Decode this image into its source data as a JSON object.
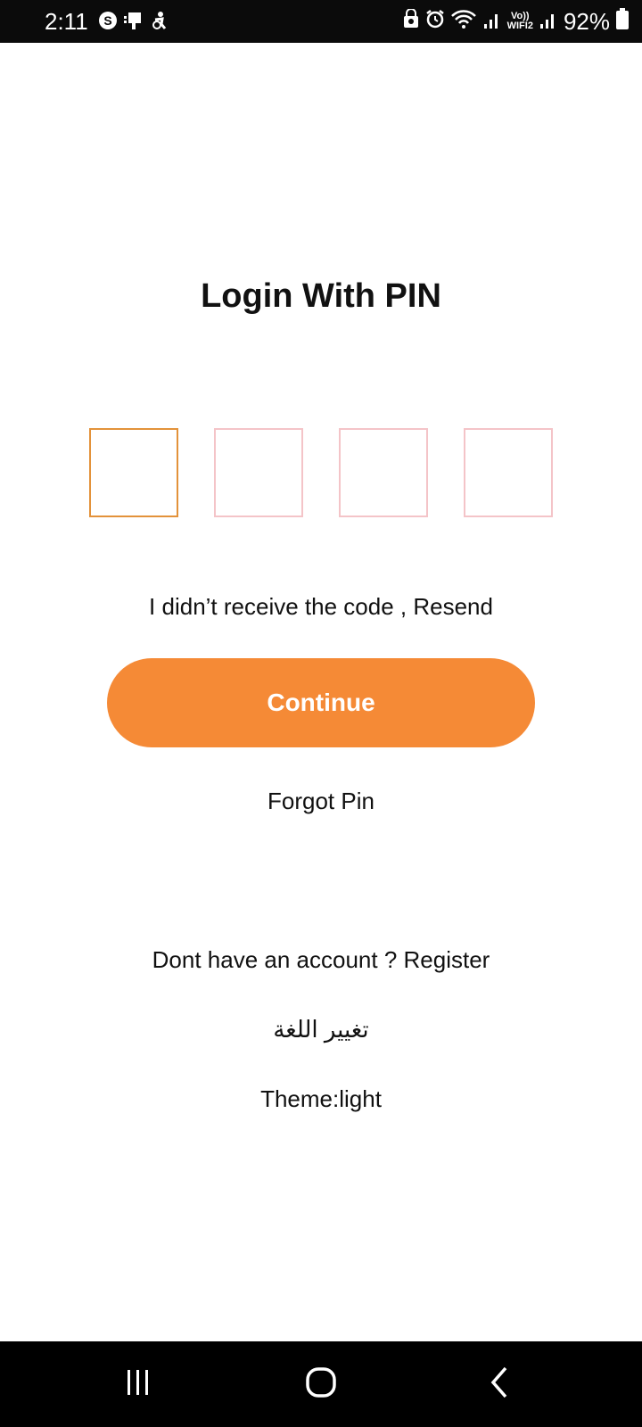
{
  "status_bar": {
    "time": "2:11",
    "vo_line1": "Vo))",
    "vo_line2": "WIFI2",
    "battery": "92%"
  },
  "login": {
    "title": "Login With PIN",
    "pin_length": 4,
    "resend_text": "I didn’t receive the code , Resend",
    "continue_label": "Continue",
    "forgot_pin_label": "Forgot Pin",
    "register_text": "Dont have an account ? Register",
    "change_language_label": "تغيير اللغة",
    "theme_label": "Theme:light"
  },
  "colors": {
    "accent": "#f58a36",
    "active_pin_border": "#e3923a",
    "inactive_pin_border": "#f4c4c8"
  },
  "icons": {
    "status_left": [
      "skype-icon",
      "device-sync-icon",
      "accessibility-icon"
    ],
    "status_right": [
      "vpn-lock-icon",
      "alarm-icon",
      "wifi-icon",
      "signal-icon",
      "signal-icon",
      "battery-icon"
    ],
    "nav": [
      "recent-apps-icon",
      "home-icon",
      "back-icon"
    ]
  }
}
